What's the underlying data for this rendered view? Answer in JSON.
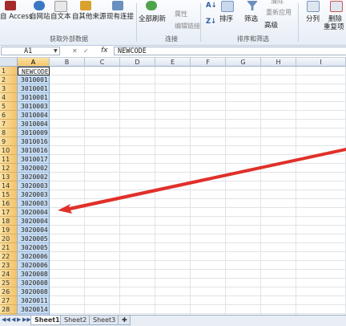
{
  "ribbon": {
    "buttons": {
      "access": "自 Access",
      "web": "自网站",
      "text": "自文本",
      "other_sources": "自其他来源",
      "existing_connections": "现有连接",
      "refresh_all": "全部刷新",
      "properties": "属性",
      "edit_links": "编辑链接",
      "sort": "排序",
      "filter": "筛选",
      "clear": "清除",
      "reapply": "重新应用",
      "advanced": "高级",
      "text_to_columns": "分列",
      "remove_duplicates_1": "删除",
      "remove_duplicates_2": "重复项"
    },
    "groups": {
      "get_external": "获取外部数据",
      "connections": "连接",
      "sort_filter": "排序和筛选"
    }
  },
  "formula_bar": {
    "name_box": "A1",
    "fx": "fx",
    "content": "NEWCODE"
  },
  "columns": [
    "A",
    "B",
    "C",
    "D",
    "E",
    "F",
    "G",
    "H",
    "I"
  ],
  "rows": [
    {
      "num": "1",
      "a": "NEWCODE"
    },
    {
      "num": "2",
      "a": "3010001"
    },
    {
      "num": "3",
      "a": "3010001"
    },
    {
      "num": "4",
      "a": "3010001"
    },
    {
      "num": "5",
      "a": "3010003"
    },
    {
      "num": "6",
      "a": "3010004"
    },
    {
      "num": "7",
      "a": "3010004"
    },
    {
      "num": "8",
      "a": "3010009"
    },
    {
      "num": "9",
      "a": "3010016"
    },
    {
      "num": "10",
      "a": "3010016"
    },
    {
      "num": "11",
      "a": "3010017"
    },
    {
      "num": "12",
      "a": "3020002"
    },
    {
      "num": "13",
      "a": "3020002"
    },
    {
      "num": "14",
      "a": "3020003"
    },
    {
      "num": "15",
      "a": "3020003"
    },
    {
      "num": "16",
      "a": "3020003"
    },
    {
      "num": "17",
      "a": "3020004"
    },
    {
      "num": "18",
      "a": "3020004"
    },
    {
      "num": "19",
      "a": "3020004"
    },
    {
      "num": "20",
      "a": "3020005"
    },
    {
      "num": "21",
      "a": "3020005"
    },
    {
      "num": "22",
      "a": "3020006"
    },
    {
      "num": "23",
      "a": "3020006"
    },
    {
      "num": "24",
      "a": "3020008"
    },
    {
      "num": "25",
      "a": "3020008"
    },
    {
      "num": "26",
      "a": "3020008"
    },
    {
      "num": "27",
      "a": "3020011"
    },
    {
      "num": "28",
      "a": "3020014"
    },
    {
      "num": "29",
      "a": "3020014"
    }
  ],
  "sheets": [
    "Sheet1",
    "Sheet2",
    "Sheet3"
  ],
  "active_sheet": "Sheet1",
  "colors": {
    "selection_fill": "#c7dcf2",
    "header_highlight": "#f4c66a",
    "annotation_arrow": "#e0302a"
  }
}
